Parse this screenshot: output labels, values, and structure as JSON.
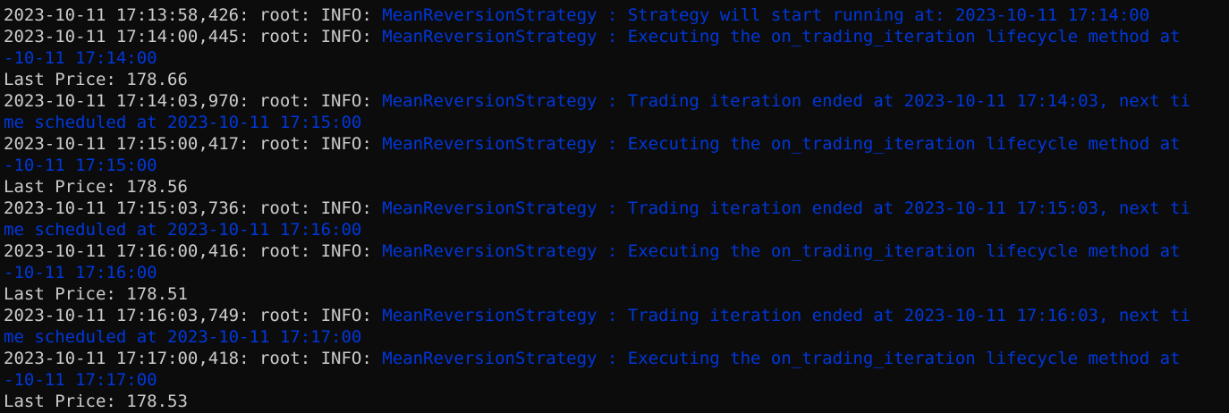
{
  "terminal": {
    "background": "#0c0c0c",
    "text_color": "#cccccc",
    "message_color": "#0037da",
    "lines": [
      {
        "prefix": "2023-10-11 17:13:58,426: root: INFO: ",
        "message": "MeanReversionStrategy : Strategy will start running at: 2023-10-11 17:14:00"
      },
      {
        "prefix": "2023-10-11 17:14:00,445: root: INFO: ",
        "message": "MeanReversionStrategy : Executing the on_trading_iteration lifecycle method at"
      },
      {
        "prefix": "",
        "message": "-10-11 17:14:00"
      },
      {
        "prefix": "Last Price: 178.66",
        "message": ""
      },
      {
        "prefix": "2023-10-11 17:14:03,970: root: INFO: ",
        "message": "MeanReversionStrategy : Trading iteration ended at 2023-10-11 17:14:03, next ti"
      },
      {
        "prefix": "",
        "message": "me scheduled at 2023-10-11 17:15:00"
      },
      {
        "prefix": "2023-10-11 17:15:00,417: root: INFO: ",
        "message": "MeanReversionStrategy : Executing the on_trading_iteration lifecycle method at"
      },
      {
        "prefix": "",
        "message": "-10-11 17:15:00"
      },
      {
        "prefix": "Last Price: 178.56",
        "message": ""
      },
      {
        "prefix": "2023-10-11 17:15:03,736: root: INFO: ",
        "message": "MeanReversionStrategy : Trading iteration ended at 2023-10-11 17:15:03, next ti"
      },
      {
        "prefix": "",
        "message": "me scheduled at 2023-10-11 17:16:00"
      },
      {
        "prefix": "2023-10-11 17:16:00,416: root: INFO: ",
        "message": "MeanReversionStrategy : Executing the on_trading_iteration lifecycle method at"
      },
      {
        "prefix": "",
        "message": "-10-11 17:16:00"
      },
      {
        "prefix": "Last Price: 178.51",
        "message": ""
      },
      {
        "prefix": "2023-10-11 17:16:03,749: root: INFO: ",
        "message": "MeanReversionStrategy : Trading iteration ended at 2023-10-11 17:16:03, next ti"
      },
      {
        "prefix": "",
        "message": "me scheduled at 2023-10-11 17:17:00"
      },
      {
        "prefix": "2023-10-11 17:17:00,418: root: INFO: ",
        "message": "MeanReversionStrategy : Executing the on_trading_iteration lifecycle method at"
      },
      {
        "prefix": "",
        "message": "-10-11 17:17:00"
      },
      {
        "prefix": "Last Price: 178.53",
        "message": ""
      }
    ]
  }
}
